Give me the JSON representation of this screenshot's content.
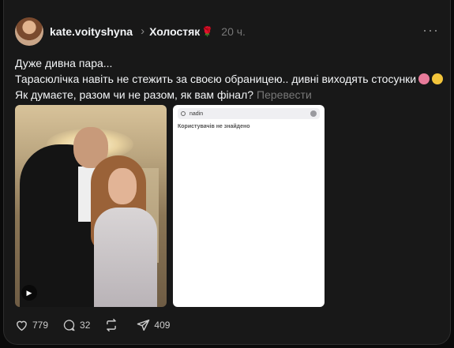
{
  "post": {
    "username": "kate.voityshyna",
    "topic": "Холостяк",
    "topic_emoji": "🌹",
    "time": "20 ч.",
    "more": "···",
    "lines": [
      "Дуже дивна пара...",
      "Тарасюлічка навіть не стежить за своєю обраницею.. дивні виходять стосунки",
      "Як думаєте, разом чи не разом, як вам фінал?"
    ],
    "translate": "Перевести"
  },
  "screenshot": {
    "search_query": "nadin",
    "empty_state": "Користувачів не знайдено"
  },
  "actions": {
    "likes": "779",
    "comments": "32",
    "shares": "409"
  },
  "colors": {
    "background": "#181818",
    "text": "#f3f5f7",
    "muted": "#777777"
  }
}
